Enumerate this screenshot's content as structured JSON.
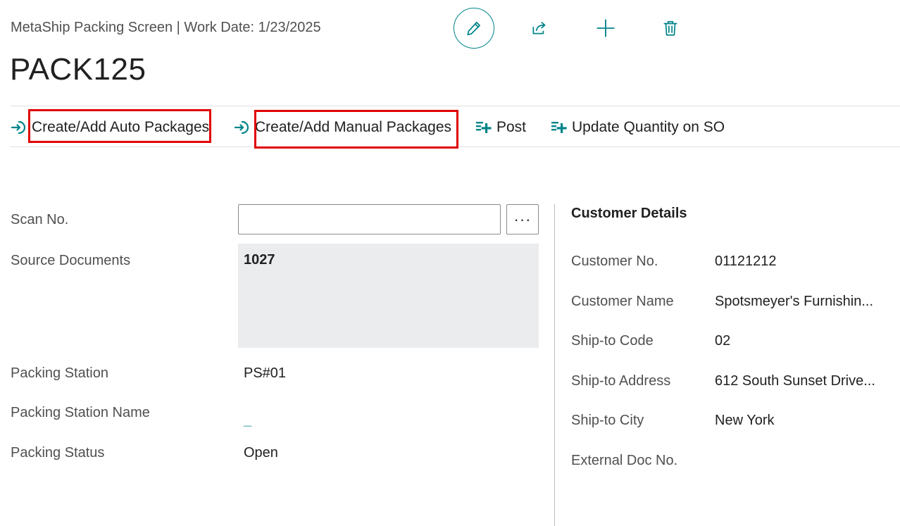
{
  "header": {
    "breadcrumb": "MetaShip Packing Screen | Work Date: 1/23/2025",
    "title": "PACK125",
    "actions": [
      {
        "icon": "pencil-icon",
        "label": "Edit"
      },
      {
        "icon": "share-icon",
        "label": "Share"
      },
      {
        "icon": "plus-icon",
        "label": "New"
      },
      {
        "icon": "trash-icon",
        "label": "Delete"
      }
    ]
  },
  "actionbar": {
    "items": [
      {
        "label": "Create/Add Auto Packages",
        "icon": "arrow-into-icon",
        "highlighted": true
      },
      {
        "label": "Create/Add Manual Packages",
        "icon": "arrow-into-icon",
        "highlighted": true
      },
      {
        "label": "Post",
        "icon": "post-icon",
        "highlighted": false
      },
      {
        "label": "Update Quantity on SO",
        "icon": "post-icon",
        "highlighted": false
      }
    ]
  },
  "general": {
    "scan_no": {
      "label": "Scan No.",
      "value": "",
      "lookup_label": "···"
    },
    "source_documents": {
      "label": "Source Documents",
      "value": "1027"
    },
    "packing_station": {
      "label": "Packing Station",
      "value": "PS#01"
    },
    "packing_station_name": {
      "label": "Packing Station Name",
      "value": "_"
    },
    "packing_status": {
      "label": "Packing Status",
      "value": "Open"
    }
  },
  "customer": {
    "title": "Customer Details",
    "fields": [
      {
        "label": "Customer No.",
        "value": "01121212"
      },
      {
        "label": "Customer Name",
        "value": "Spotsmeyer's Furnishin..."
      },
      {
        "label": "Ship-to Code",
        "value": "02"
      },
      {
        "label": "Ship-to Address",
        "value": "612 South Sunset Drive..."
      },
      {
        "label": "Ship-to City",
        "value": "New York"
      },
      {
        "label": "External Doc No.",
        "value": ""
      }
    ]
  },
  "colors": {
    "accent": "#008489",
    "highlight": "#e00000",
    "readonly_bg": "#ebecee"
  }
}
